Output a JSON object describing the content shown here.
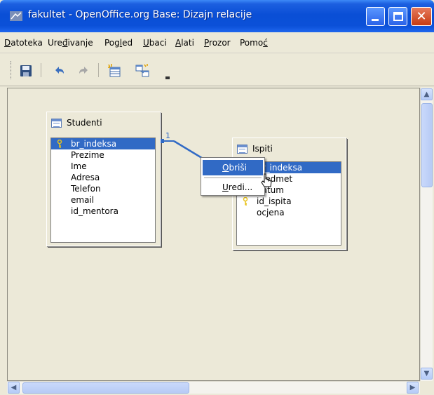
{
  "window": {
    "title": "fakultet - OpenOffice.org Base: Dizajn relacije",
    "close_glyph": "✕"
  },
  "menu": [
    {
      "label": "Datoteka",
      "mnemonic": "D"
    },
    {
      "label": "Uređivanje",
      "mnemonic": "đ"
    },
    {
      "label": "Pogled",
      "mnemonic": "l"
    },
    {
      "label": "Ubaci",
      "mnemonic": "U"
    },
    {
      "label": "Alati",
      "mnemonic": "A"
    },
    {
      "label": "Prozor",
      "mnemonic": "P"
    },
    {
      "label": "Pomoć",
      "mnemonic": "ć"
    }
  ],
  "toolbar": {
    "icons": [
      "save-icon",
      "undo-icon",
      "redo-icon",
      "new-table-icon",
      "new-relation-icon"
    ]
  },
  "tables": {
    "studenti": {
      "title": "Studenti",
      "fields": [
        {
          "name": "br_indeksa",
          "key": true,
          "selected": true
        },
        {
          "name": "Prezime",
          "key": false,
          "selected": false
        },
        {
          "name": "Ime",
          "key": false,
          "selected": false
        },
        {
          "name": "Adresa",
          "key": false,
          "selected": false
        },
        {
          "name": "Telefon",
          "key": false,
          "selected": false
        },
        {
          "name": "email",
          "key": false,
          "selected": false
        },
        {
          "name": "id_mentora",
          "key": false,
          "selected": false
        }
      ]
    },
    "ispiti": {
      "title": "Ispiti",
      "fields": [
        {
          "name": "br_indeksa",
          "key": false,
          "selected": true
        },
        {
          "name": "predmet",
          "key": false,
          "selected": false
        },
        {
          "name": "datum",
          "key": false,
          "selected": false
        },
        {
          "name": "id_ispita",
          "key": true,
          "selected": false
        },
        {
          "name": "ocjena",
          "key": false,
          "selected": false
        }
      ]
    }
  },
  "relation": {
    "cardinality_label": "1"
  },
  "context_menu": {
    "items": [
      {
        "label": "Obriši",
        "highlighted": true
      },
      {
        "label": "Uredi...",
        "highlighted": false
      }
    ]
  },
  "colors": {
    "titlebar": "#0a4fd6",
    "selection": "#316ac5",
    "relation_line": "#316ac5",
    "key_icon": "#e8c21b"
  }
}
